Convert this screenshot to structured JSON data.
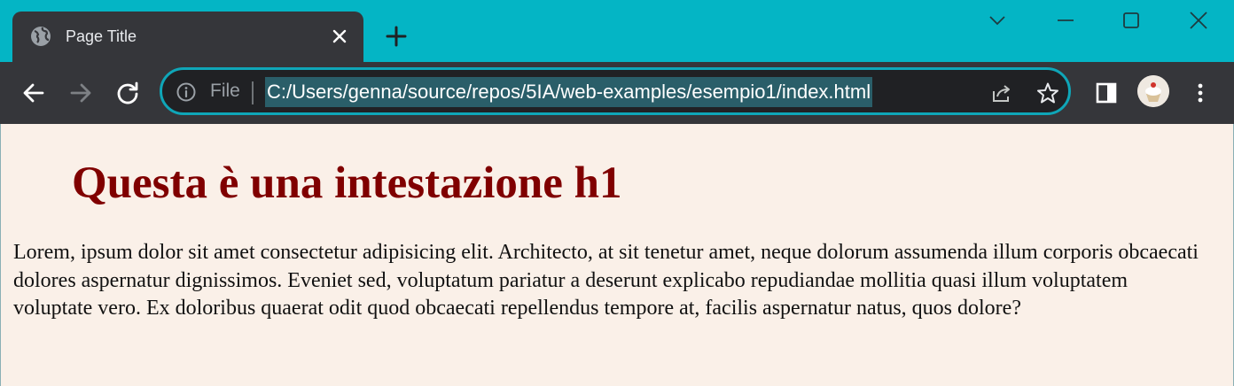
{
  "browser": {
    "tab": {
      "title": "Page Title",
      "favicon": "globe-icon"
    },
    "address_bar": {
      "security_label": "File",
      "url": "C:/Users/genna/source/repos/5IA/web-examples/esempio1/index.html"
    },
    "accent_color": "#04b5c5",
    "toolbar_color": "#35363a"
  },
  "page": {
    "heading": "Questa è una intestazione h1",
    "paragraph": "Lorem, ipsum dolor sit amet consectetur adipisicing elit. Architecto, at sit tenetur amet, neque dolorum assumenda illum corporis obcaecati dolores aspernatur dignissimos. Eveniet sed, voluptatum pariatur a deserunt explicabo repudiandae mollitia quasi illum voluptatem voluptate vero. Ex doloribus quaerat odit quod obcaecati repellendus tempore at, facilis aspernatur natus, quos dolore?",
    "background_color": "#faf0e8",
    "heading_color": "#800000"
  }
}
